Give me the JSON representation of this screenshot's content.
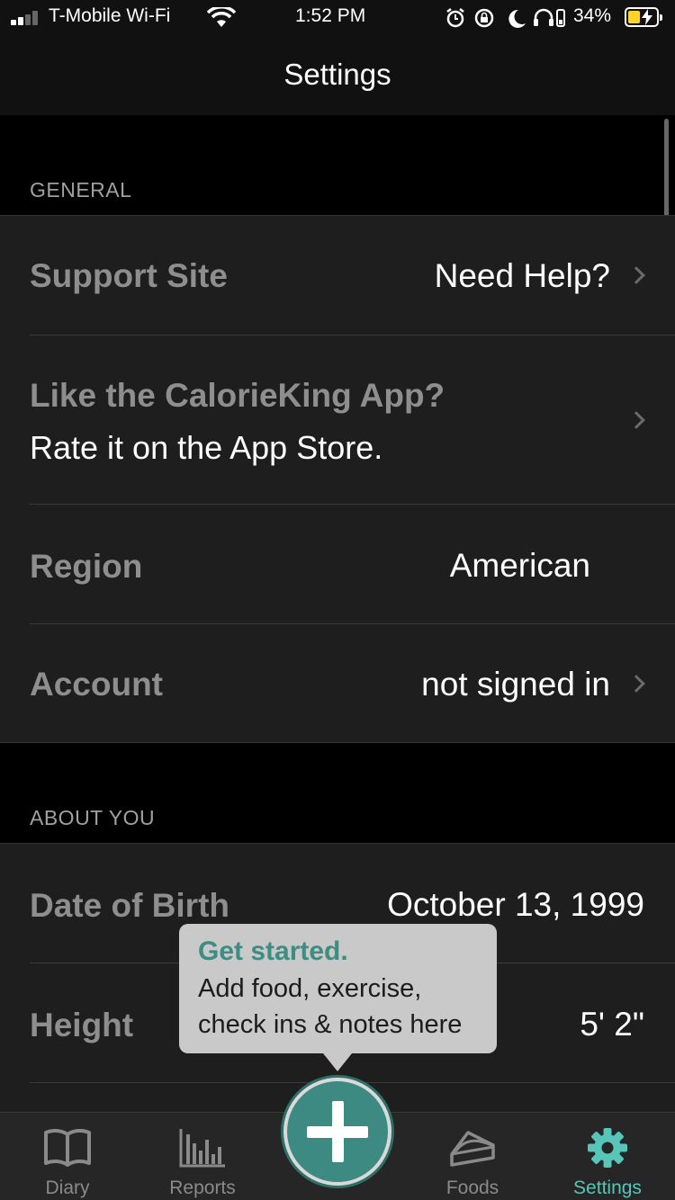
{
  "status_bar": {
    "carrier": "T-Mobile Wi-Fi",
    "time": "1:52 PM",
    "battery_percent": "34%",
    "battery_level": 0.34,
    "icons": [
      "signal-icon",
      "wifi-icon",
      "alarm-icon",
      "rotation-lock-icon",
      "moon-icon",
      "headphones-icon",
      "battery-icon"
    ]
  },
  "nav": {
    "title": "Settings"
  },
  "sections": {
    "general": {
      "header": "GENERAL",
      "support_label": "Support Site",
      "support_value": "Need Help?",
      "rate_label": "Like the CalorieKing App?",
      "rate_sub": "Rate it on the App Store.",
      "region_label": "Region",
      "region_value": "American",
      "account_label": "Account",
      "account_value": "not signed in"
    },
    "about": {
      "header": "ABOUT YOU",
      "dob_label": "Date of Birth",
      "dob_value": "October 13, 1999",
      "height_label": "Height",
      "height_value": "5' 2\""
    }
  },
  "tooltip": {
    "title": "Get started.",
    "line1": "Add food, exercise,",
    "line2": "check ins & notes here"
  },
  "tabs": {
    "diary": "Diary",
    "reports": "Reports",
    "foods": "Foods",
    "settings": "Settings",
    "active": "settings"
  },
  "colors": {
    "accent": "#57c6b8",
    "add_button": "#3d8a82",
    "tooltip_title": "#3e8d83",
    "battery_fill": "#ffd42a"
  }
}
